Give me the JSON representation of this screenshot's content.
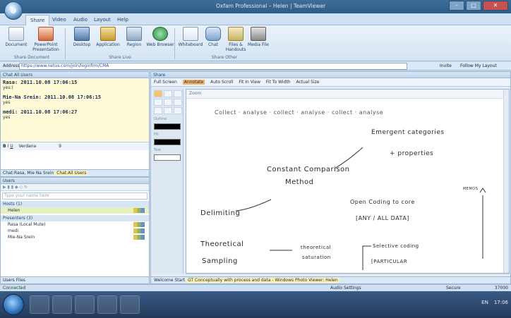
{
  "window": {
    "title": "Oxfam Professional – Helen | TeamViewer",
    "controls": [
      "–",
      "□",
      "✕"
    ]
  },
  "menu_tabs": [
    "Share",
    "Video",
    "Audio",
    "Layout",
    "Help"
  ],
  "ribbon": {
    "groups": [
      {
        "label": "Share Document",
        "buttons": [
          "Document",
          "PowerPoint Presentation"
        ]
      },
      {
        "label": "Share Live",
        "buttons": [
          "Desktop",
          "Application",
          "Region",
          "Web Browser"
        ]
      },
      {
        "label": "Share Other",
        "buttons": [
          "Whiteboard",
          "Chat",
          "Files & Handouts",
          "Media File"
        ]
      }
    ]
  },
  "address": {
    "label": "Address",
    "value": "https://www.netus.com/join/loginfrm/CMA",
    "invite": "Invite",
    "follow": "Follow My Layout"
  },
  "chat": {
    "header": "Chat All Users",
    "messages": [
      {
        "head": "Rasa: 2011.10.08 17:06:15",
        "body": "yes:)"
      },
      {
        "head": "Mie-Na Srein: 2011.10.08 17:06:15",
        "body": "yes"
      },
      {
        "head": "medi: 2011.10.08 17:06:27",
        "body": "yes"
      }
    ],
    "font": "Verdana",
    "font_size": "9",
    "bottom_tabs": [
      "Chat:Rasa, Mie Na Srein",
      "Chat:All Users"
    ]
  },
  "users": {
    "header": "Users",
    "filter_placeholder": "Type your name here",
    "groups": [
      {
        "name": "Hosts (1)",
        "members": [
          "Helen"
        ]
      },
      {
        "name": "Presenters (3)",
        "members": [
          "Rasa (Local Mute)",
          "medi",
          "Mie-Na Srein"
        ]
      }
    ],
    "footer_tabs": [
      "Users",
      "Files"
    ]
  },
  "share": {
    "header": "Share",
    "toolbar": [
      "Full Screen",
      "Annotate",
      "Auto Scroll",
      "Fit In View",
      "Fit To Width",
      "Actual Size"
    ],
    "tool_labels": [
      "Outline",
      "Fill",
      "Text"
    ],
    "board_top": "Zoom",
    "handwriting": {
      "line1": "Collect · analyse · collect · analyse · collect · analyse",
      "emergent": "Emergent categories",
      "props": "+ properties",
      "cc1": "Constant Comparison",
      "cc2": "Method",
      "memos": "MEMOS",
      "opencoding": "Open Coding to core",
      "anyall": "[ANY / ALL DATA]",
      "delimiting": "Delimiting",
      "theoretical1": "Theoretical",
      "theoretical2": "Sampling",
      "saturation1": "theoretical",
      "saturation2": "saturation",
      "selective": "Selective coding",
      "particular": "[PARTICULAR"
    },
    "bottom_tabs": [
      "Welcome",
      "Start",
      "GT Conceptually with process and data - Windows Photo Viewer: Helen"
    ]
  },
  "status": {
    "left": "Connected",
    "audio": "Audio Settings",
    "secure": "Secure",
    "speed": "37000"
  },
  "taskbar": {
    "lang": "EN",
    "time": "17:06"
  }
}
